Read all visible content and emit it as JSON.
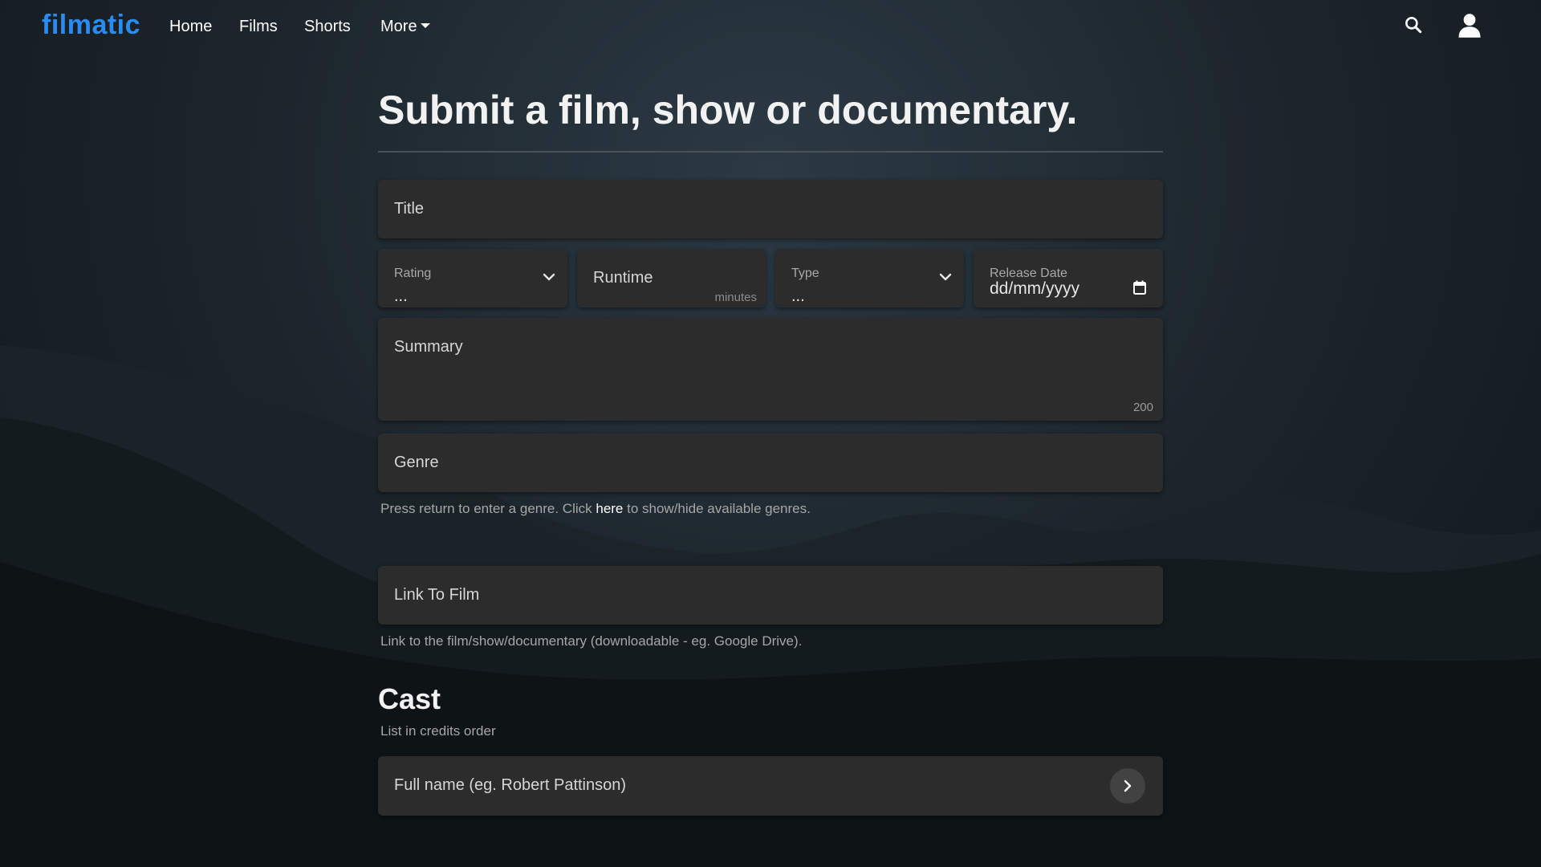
{
  "nav": {
    "logo": "filmatic",
    "links": [
      "Home",
      "Films",
      "Shorts",
      "More"
    ],
    "icons": [
      "search-icon",
      "user-icon"
    ]
  },
  "page": {
    "title": "Submit a film, show or documentary."
  },
  "form": {
    "title_placeholder": "Title",
    "rating": {
      "label": "Rating",
      "value": "..."
    },
    "runtime": {
      "placeholder": "Runtime",
      "suffix": "minutes"
    },
    "type": {
      "label": "Type",
      "value": "..."
    },
    "release_date": {
      "label": "Release Date",
      "value": "dd/mm/yyyy"
    },
    "summary": {
      "placeholder": "Summary",
      "counter": "200"
    },
    "genre": {
      "placeholder": "Genre",
      "help_before": "Press return to enter a genre. Click",
      "help_link": "here",
      "help_after": "to show/hide available genres."
    },
    "link": {
      "placeholder": "Link To Film",
      "help": "Link to the film/show/documentary (downloadable - eg. Google Drive)."
    }
  },
  "cast": {
    "heading": "Cast",
    "subtitle": "List in credits order",
    "name_placeholder": "Full name (eg. Robert Pattinson)"
  },
  "colors": {
    "accent": "#2a8cf0",
    "field_bg": "#2c2c2c"
  }
}
